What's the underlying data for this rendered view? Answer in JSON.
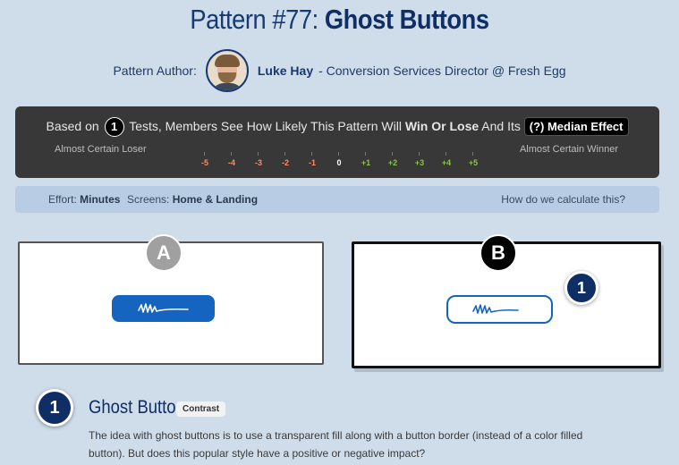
{
  "header": {
    "title_prefix": "Pattern #77:",
    "title_main": "Ghost Buttons"
  },
  "author": {
    "label": "Pattern Author:",
    "name": "Luke Hay",
    "role": " - Conversion Services Director @ Fresh Egg"
  },
  "summary": {
    "based_on": "Based on",
    "tests_count": "1",
    "text_mid": "Tests, Members See How Likely This Pattern Will",
    "win_lose": "Win Or Lose",
    "text_end": "And Its",
    "median_label": "(?) Median Effect",
    "left_label": "Almost Certain Loser",
    "right_label": "Almost Certain Winner",
    "scale": [
      {
        "label": "-5",
        "color": "#ff8a65"
      },
      {
        "label": "-4",
        "color": "#ff8a65"
      },
      {
        "label": "-3",
        "color": "#ff8a65"
      },
      {
        "label": "-2",
        "color": "#ff8a65"
      },
      {
        "label": "-1",
        "color": "#ff8a65"
      },
      {
        "label": "0",
        "color": "#ffffff"
      },
      {
        "label": "+1",
        "color": "#8bc34a"
      },
      {
        "label": "+2",
        "color": "#8bc34a"
      },
      {
        "label": "+3",
        "color": "#8bc34a"
      },
      {
        "label": "+4",
        "color": "#8bc34a"
      },
      {
        "label": "+5",
        "color": "#8bc34a"
      }
    ]
  },
  "info": {
    "effort_label": "Effort:",
    "effort_value": "Minutes",
    "screens_label": "Screens:",
    "screens_value": "Home & Landing",
    "how_link": "How do we calculate this?"
  },
  "variants": {
    "a_label": "A",
    "b_label": "B",
    "b_marker": "1",
    "primary_color": "#1565c0"
  },
  "change": {
    "number": "1",
    "title": "Ghost Button",
    "tag": "Contrast",
    "description": "The idea with ghost buttons is to use a transparent fill along with a button border (instead of a color filled button). But does this popular style have a positive or negative impact?"
  }
}
